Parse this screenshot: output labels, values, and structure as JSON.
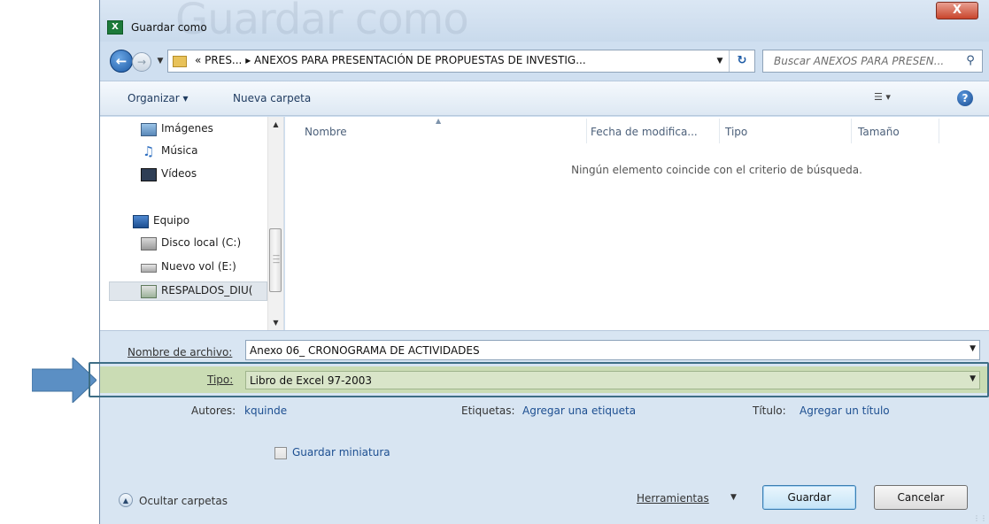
{
  "window": {
    "title": "Guardar como",
    "title_watermark": "Guardar como",
    "close_glyph": "X"
  },
  "navigation": {
    "address_path": "« PRES... ▸ ANEXOS PARA PRESENTACIÓN DE PROPUESTAS DE INVESTIG...",
    "search_placeholder": "Buscar ANEXOS PARA PRESEN..."
  },
  "toolbar": {
    "organize_label": "Organizar ▾",
    "new_folder_label": "Nueva carpeta"
  },
  "nav_pane": {
    "items": [
      {
        "label": "Imágenes",
        "icon": "pictures-icon"
      },
      {
        "label": "Música",
        "icon": "music-icon"
      },
      {
        "label": "Vídeos",
        "icon": "videos-icon"
      },
      {
        "label": "Equipo",
        "icon": "computer-icon"
      },
      {
        "label": "Disco local (C:)",
        "icon": "local-disk-icon"
      },
      {
        "label": "Nuevo vol (E:)",
        "icon": "drive-icon"
      },
      {
        "label": "RESPALDOS_DIU(",
        "icon": "network-drive-icon"
      }
    ]
  },
  "file_list": {
    "columns": [
      "Nombre",
      "Fecha de modifica...",
      "Tipo",
      "Tamaño"
    ],
    "empty_message": "Ningún elemento coincide con el criterio de búsqueda."
  },
  "form": {
    "filename_label": "Nombre de archivo:",
    "filename_value": "Anexo 06_ CRONOGRAMA DE ACTIVIDADES",
    "type_label": "Tipo:",
    "type_value": "Libro de Excel 97-2003",
    "authors_label": "Autores:",
    "authors_value": "kquinde",
    "tags_label": "Etiquetas:",
    "tags_value": "Agregar una etiqueta",
    "title_label": "Título:",
    "title_value": "Agregar un título",
    "thumbnail_label": "Guardar miniatura"
  },
  "footer": {
    "hide_folders_label": "Ocultar carpetas",
    "tools_label": "Herramientas",
    "save_label": "Guardar",
    "cancel_label": "Cancelar"
  },
  "colors": {
    "highlight_row": "#cadcb4",
    "arrow": "#5b8fc4",
    "link": "#1d4f91"
  }
}
